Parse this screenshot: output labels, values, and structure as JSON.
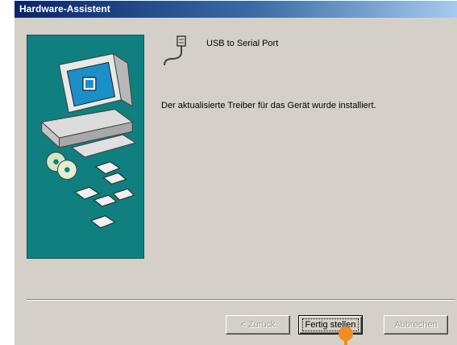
{
  "window": {
    "title": "Hardware-Assistent"
  },
  "device": {
    "icon": "serial-port-icon",
    "name": "USB to Serial Port"
  },
  "message": "Der aktualisierte Treiber für das Gerät wurde installiert.",
  "buttons": {
    "back_label": "< Zurück",
    "finish_label": "Fertig stellen",
    "cancel_label": "Abbrechen"
  },
  "colors": {
    "title_bar": "#0a246a",
    "banner": "#0f7f7f",
    "dialog_bg": "#d4d0c8",
    "cursor_marker": "#f28c1e"
  }
}
